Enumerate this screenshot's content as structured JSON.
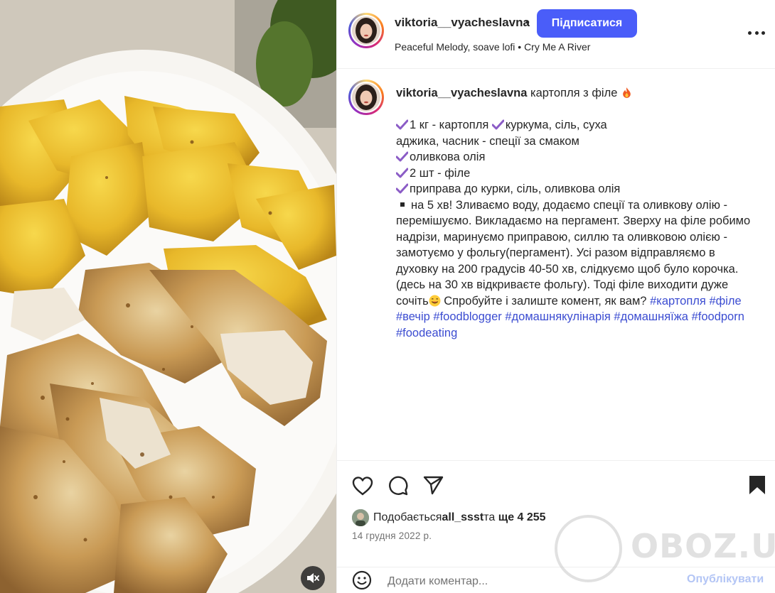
{
  "post": {
    "username": "viktoria__vyacheslavna",
    "separator_dot": "•",
    "follow_label": "Підписатися",
    "audio": "Peaceful Melody, soave lofi • Cry Me A River"
  },
  "caption": {
    "username": "viktoria__vyacheslavna",
    "title": "картопля з філе",
    "line1_a": "1 кг - картопля",
    "line1_b": "куркума, сіль, суха",
    "line2": "аджика, часник - спеції за смаком",
    "line3": "оливкова олія",
    "line4": "2 шт - філе",
    "line5": "приправа до курки, сіль, оливкова олія",
    "body1": "на 5 хв! Зливаємо воду, додаємо спеції та оливкову олію - перемішуємо. Викладаємо на пергамент.     Зверху на філе робимо надрізи, маринуємо приправою, силлю та оливковою олією - замотуємо у фольгу(пергамент).     Усі разом відправляємо в духовку на 200 градусів 40-50 хв, слідкуємо щоб було корочка. (десь на 30 хв відкриваєте фольгу). Тоді філе виходити дуже сочіть",
    "body2": "     Спробуйте і залиште комент, як вам? ",
    "hashtags": [
      "#картопля",
      "#філе",
      "#вечір",
      "#foodblogger",
      "#домашнякулінарія",
      "#домашняїжа",
      "#foodporn",
      "#foodeating"
    ]
  },
  "likes": {
    "prefix": "Подобається",
    "user": "all_ssst",
    "middle": "та ",
    "others": "ще 4 255"
  },
  "date": "14 грудня 2022 р.",
  "comment": {
    "placeholder": "Додати коментар...",
    "publish_label": "Опублікувати"
  },
  "watermark": "OBOZ.UA",
  "icons": [
    "heart-icon",
    "comment-icon",
    "share-icon",
    "bookmark-icon",
    "emoji-icon",
    "more-icon",
    "mute-icon"
  ],
  "colors": {
    "accent": "#4a5df9",
    "hashtag": "#3b4cd1",
    "check": "#8b5cc6"
  }
}
